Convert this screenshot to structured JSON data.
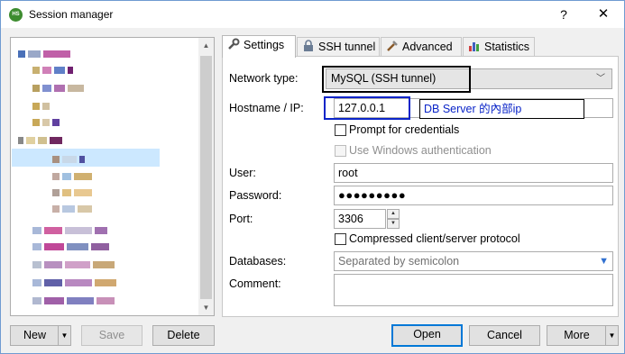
{
  "window": {
    "title": "Session manager",
    "app_icon_text": "HS",
    "help_symbol": "?",
    "close_symbol": "✕"
  },
  "tabs": [
    {
      "label": "Settings",
      "icon": "wrench-icon",
      "active": true
    },
    {
      "label": "SSH tunnel",
      "icon": "lock-icon",
      "active": false
    },
    {
      "label": "Advanced",
      "icon": "tools-icon",
      "active": false
    },
    {
      "label": "Statistics",
      "icon": "bar-chart-icon",
      "active": false
    }
  ],
  "settings": {
    "network_type_label": "Network type:",
    "network_type_value": "MySQL (SSH tunnel)",
    "hostname_label": "Hostname / IP:",
    "hostname_value": "127.0.0.1",
    "hostname_annotation": "DB Server 的內部ip",
    "prompt_credentials_label": "Prompt for credentials",
    "windows_auth_label": "Use Windows authentication",
    "user_label": "User:",
    "user_value": "root",
    "password_label": "Password:",
    "password_value": "●●●●●●●●●",
    "port_label": "Port:",
    "port_value": "3306",
    "compressed_label": "Compressed client/server protocol",
    "databases_label": "Databases:",
    "databases_placeholder": "Separated by semicolon",
    "comment_label": "Comment:"
  },
  "buttons": {
    "new": "New",
    "save": "Save",
    "delete": "Delete",
    "open": "Open",
    "cancel": "Cancel",
    "more": "More"
  },
  "colors": {
    "accent": "#0078d7",
    "selection": "#cce8ff",
    "annotation_blue": "#0a24c8"
  }
}
